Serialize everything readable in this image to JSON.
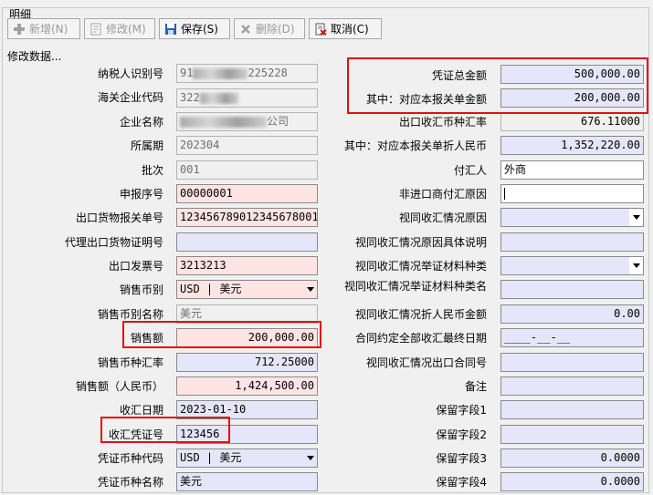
{
  "panel": {
    "title": "明细"
  },
  "toolbar": {
    "add": "新增(N)",
    "edit": "修改(M)",
    "save": "保存(S)",
    "delete": "删除(D)",
    "cancel": "取消(C)"
  },
  "status": "修改数据...",
  "left": [
    {
      "label": "纳税人识别号",
      "value": "91",
      "value_tail": "225228"
    },
    {
      "label": "海关企业代码",
      "value": "322"
    },
    {
      "label": "企业名称",
      "value": "",
      "value_tail": "公司"
    },
    {
      "label": "所属期",
      "value": "202304"
    },
    {
      "label": "批次",
      "value": "001"
    },
    {
      "label": "申报序号",
      "value": "00000001"
    },
    {
      "label": "出口货物报关单号",
      "value": "123456789012345678001"
    },
    {
      "label": "代理出口货物证明号",
      "value": ""
    },
    {
      "label": "出口发票号",
      "value": "3213213"
    },
    {
      "label": "销售币别",
      "value": "USD | 美元"
    },
    {
      "label": "销售币别名称",
      "value": "美元"
    },
    {
      "label": "销售额",
      "value": "200,000.00"
    },
    {
      "label": "销售币种汇率",
      "value": "712.25000"
    },
    {
      "label": "销售额（人民币）",
      "value": "1,424,500.00"
    },
    {
      "label": "收汇日期",
      "value": "2023-01-10"
    },
    {
      "label": "收汇凭证号",
      "value": "123456"
    },
    {
      "label": "凭证币种代码",
      "value": "USD | 美元"
    },
    {
      "label": "凭证币种名称",
      "value": "美元"
    }
  ],
  "right": [
    {
      "label": "凭证总金额",
      "value": "500,000.00"
    },
    {
      "label": "其中：对应本报关单金额",
      "value": "200,000.00"
    },
    {
      "label": "出口收汇币种汇率",
      "value": "676.11000"
    },
    {
      "label": "其中：对应本报关单折人民币",
      "value": "1,352,220.00"
    },
    {
      "label": "付汇人",
      "value": "外商"
    },
    {
      "label": "非进口商付汇原因",
      "value": ""
    },
    {
      "label": "视同收汇情况原因",
      "value": ""
    },
    {
      "label": "视同收汇情况原因具体说明",
      "value": ""
    },
    {
      "label": "视同收汇情况举证材料种类",
      "value": ""
    },
    {
      "label": "视同收汇情况举证材料种类名",
      "value": ""
    },
    {
      "label": "视同收汇情况折人民币金额",
      "value": "0.00"
    },
    {
      "label": "合同约定全部收汇最终日期",
      "value": "____-__-__"
    },
    {
      "label": "视同收汇情况出口合同号",
      "value": ""
    },
    {
      "label": "备注",
      "value": ""
    },
    {
      "label": "保留字段1",
      "value": ""
    },
    {
      "label": "保留字段2",
      "value": ""
    },
    {
      "label": "保留字段3",
      "value": "0.0000"
    },
    {
      "label": "保留字段4",
      "value": "0.0000"
    }
  ],
  "colors": {
    "highlight": "#e01010",
    "pink_field": "#ffe4e4",
    "blue_field": "#e6e6fa",
    "readonly_field": "#f0f0f0"
  }
}
